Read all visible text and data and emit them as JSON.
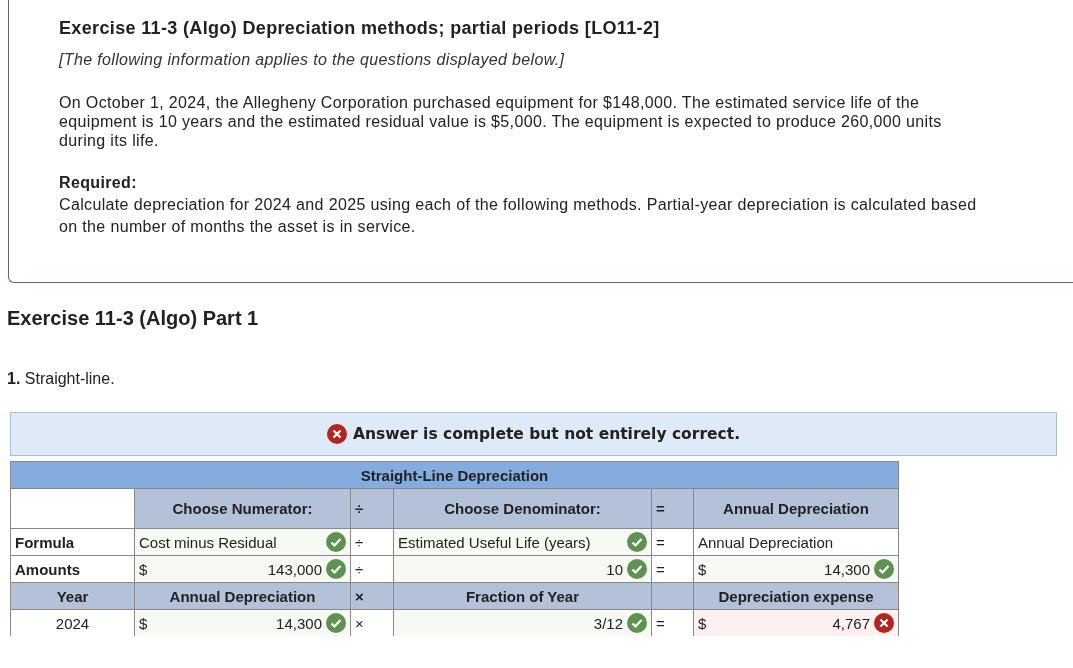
{
  "intro": {
    "title": "Exercise 11-3 (Algo) Depreciation methods; partial periods [LO11-2]",
    "note": "[The following information applies to the questions displayed below.]",
    "body": "On October 1, 2024, the Allegheny Corporation purchased equipment for $148,000. The estimated service life of the equipment is 10 years and the estimated residual value is $5,000. The equipment is expected to produce 260,000 units during its life.",
    "required_label": "Required:",
    "required_text": "Calculate depreciation for 2024 and 2025 using each of the following methods. Partial-year depreciation is calculated based on the number of months the asset is in service."
  },
  "part_title": "Exercise 11-3 (Algo) Part 1",
  "question": "**1.** Straight-line.",
  "banner": {
    "text": "Answer is complete but not entirely correct.",
    "correct": false
  },
  "table": {
    "title": "Straight-Line Depreciation",
    "rows": [
      [
        {
          "kind": "blank"
        },
        {
          "kind": "header",
          "text": "Choose Numerator:"
        },
        {
          "kind": "op_header",
          "text": "÷"
        },
        {
          "kind": "header",
          "text": "Choose Denominator:"
        },
        {
          "kind": "op_header",
          "text": "="
        },
        {
          "kind": "header",
          "text": "Annual Depreciation"
        }
      ],
      [
        {
          "kind": "label",
          "text": "Formula"
        },
        {
          "kind": "choice",
          "text": "Cost minus Residual",
          "correct": true
        },
        {
          "kind": "op",
          "text": "÷"
        },
        {
          "kind": "choice",
          "text": "Estimated Useful Life (years)",
          "correct": true
        },
        {
          "kind": "op",
          "text": "="
        },
        {
          "kind": "text",
          "text": "Annual Depreciation"
        }
      ],
      [
        {
          "kind": "label",
          "text": "Amounts"
        },
        {
          "kind": "amount",
          "prefix": "$",
          "text": "143,000",
          "correct": true
        },
        {
          "kind": "op",
          "text": "÷"
        },
        {
          "kind": "amount",
          "text": "10",
          "correct": true
        },
        {
          "kind": "op",
          "text": "="
        },
        {
          "kind": "amount",
          "prefix": "$",
          "text": "14,300",
          "correct": true
        }
      ],
      [
        {
          "kind": "header",
          "text": "Year"
        },
        {
          "kind": "header",
          "text": "Annual Depreciation"
        },
        {
          "kind": "op_header",
          "text": "×"
        },
        {
          "kind": "header",
          "text": "Fraction of Year"
        },
        {
          "kind": "blank_header"
        },
        {
          "kind": "header",
          "text": "Depreciation expense"
        }
      ],
      [
        {
          "kind": "year",
          "text": "2024"
        },
        {
          "kind": "amount",
          "prefix": "$",
          "text": "14,300",
          "correct": true
        },
        {
          "kind": "op",
          "text": "×"
        },
        {
          "kind": "amount",
          "text": "3/12",
          "correct": true
        },
        {
          "kind": "op",
          "text": "="
        },
        {
          "kind": "amount",
          "prefix": "$",
          "text": "4,767",
          "correct": false
        }
      ]
    ]
  }
}
